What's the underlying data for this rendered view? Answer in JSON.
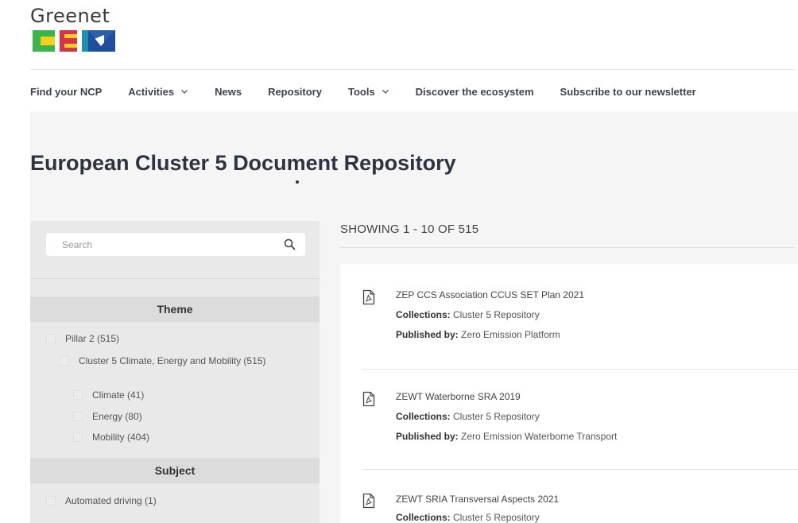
{
  "brand": {
    "name": "Greenet"
  },
  "nav": [
    {
      "label": "Find your NCP",
      "has_dropdown": false
    },
    {
      "label": "Activities",
      "has_dropdown": true
    },
    {
      "label": "News",
      "has_dropdown": false
    },
    {
      "label": "Repository",
      "has_dropdown": false
    },
    {
      "label": "Tools",
      "has_dropdown": true
    },
    {
      "label": "Discover the ecosystem",
      "has_dropdown": false
    },
    {
      "label": "Subscribe to our newsletter",
      "has_dropdown": false
    }
  ],
  "page": {
    "title": "European Cluster 5 Document Repository"
  },
  "search": {
    "placeholder": "Search"
  },
  "filters": {
    "theme": {
      "header": "Theme",
      "items": [
        {
          "label": "Pillar 2 (515)"
        },
        {
          "label": "Cluster 5 Climate, Energy and Mobility (515)"
        },
        {
          "label": "Climate (41)"
        },
        {
          "label": "Energy (80)"
        },
        {
          "label": "Mobility (404)"
        }
      ]
    },
    "subject": {
      "header": "Subject",
      "items": [
        {
          "label": "Automated driving (1)"
        }
      ]
    }
  },
  "results": {
    "showing": "SHOWING 1 - 10 OF 515",
    "collections_label": "Collections:",
    "published_label": "Published by:",
    "items": [
      {
        "title": "ZEP CCS Association CCUS SET Plan 2021",
        "collection": "Cluster 5 Repository",
        "publisher": "Zero Emission Platform"
      },
      {
        "title": "ZEWT Waterborne SRA 2019",
        "collection": "Cluster 5 Repository",
        "publisher": "Zero Emission Waterborne Transport"
      },
      {
        "title": "ZEWT SRIA Transversal Aspects 2021",
        "collection": "Cluster 5 Repository",
        "publisher": ""
      }
    ]
  },
  "colors": {
    "accent_blue": "#2f5fa8",
    "logo_green": "#3ab54a",
    "logo_yellow": "#f0b323",
    "logo_red": "#d6324a",
    "logo_teal": "#1d8fb0"
  }
}
